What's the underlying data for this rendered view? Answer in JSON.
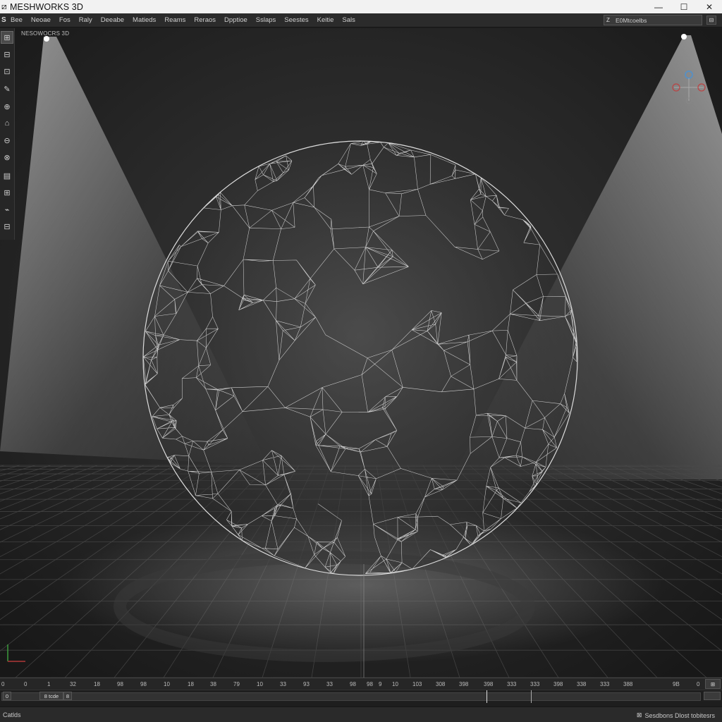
{
  "window": {
    "title": "MESHWORKS 3D",
    "minimize": "—",
    "maximize": "☐",
    "close": "✕"
  },
  "menubar": {
    "logo": "S",
    "items": [
      "Bee",
      "Neoae",
      "Fos",
      "Raly",
      "Deeabe",
      "Matieds",
      "Reams",
      "Reraos",
      "Dpptioe",
      "Sslaps",
      "Seestes",
      "Keitie",
      "Sals"
    ],
    "search_value": "E0Mtcoelbs",
    "search_icon": "Z",
    "expand_icon": "⊟"
  },
  "viewport": {
    "label": "NESOWOCRS 3D",
    "background": "#232323"
  },
  "toolbar": {
    "icons": [
      "select-icon",
      "box-icon",
      "box-select-icon",
      "brush-icon",
      "sphere-icon",
      "camera-icon",
      "shield-icon",
      "paint-icon",
      "layout-icon",
      "grid-icon",
      "bone-icon",
      "mesh-icon"
    ],
    "glyphs": [
      "⊞",
      "⊟",
      "⊡",
      "✎",
      "⊕",
      "⌂",
      "⊖",
      "⊗",
      "▤",
      "⊞",
      "⌁",
      "⊟"
    ]
  },
  "timeline": {
    "ticks": [
      "0",
      "0",
      "1",
      "32",
      "18",
      "98",
      "98",
      "10",
      "18",
      "38",
      "79",
      "10",
      "33",
      "93",
      "33",
      "98",
      "98",
      "9",
      "10",
      "103",
      "308",
      "398",
      "398",
      "333",
      "333",
      "398",
      "338",
      "333",
      "388",
      "9B",
      "0"
    ],
    "frame_start": "0",
    "frame_field_a": "8 tcde",
    "frame_field_b": "8",
    "end_button": "⊞"
  },
  "statusbar": {
    "left_text": "Catlds",
    "right_text": "Sesdbons  Dlost tobitesrs",
    "right_icon": "⊠"
  }
}
